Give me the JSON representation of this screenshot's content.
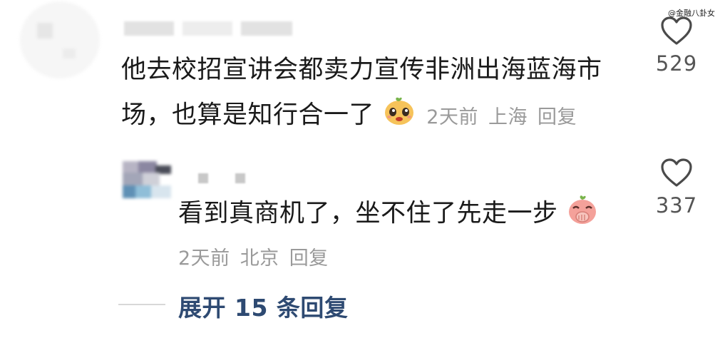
{
  "watermark": "@金融八卦女",
  "comments": [
    {
      "text_line1": "他去校招宣讲会都卖力宣传非洲出海蓝海市",
      "text_line2": "场，也算是知行合一了",
      "emoji": "smiling-face-emoji",
      "time": "2天前",
      "location": "上海",
      "reply_label": "回复",
      "likes": "529"
    },
    {
      "text_line1": "看到真商机了，坐不住了先走一步",
      "emoji": "covering-mouth-emoji",
      "time": "2天前",
      "location": "北京",
      "reply_label": "回复",
      "likes": "337"
    }
  ],
  "expand_replies": "展开 15 条回复",
  "icons": {
    "like": "heart-outline-icon"
  },
  "colors": {
    "text": "#1a1a1a",
    "meta": "#9a9a9a",
    "expand": "#2e4a72",
    "emoji_face": "#f6c35a",
    "emoji_pink": "#f4a19a"
  }
}
